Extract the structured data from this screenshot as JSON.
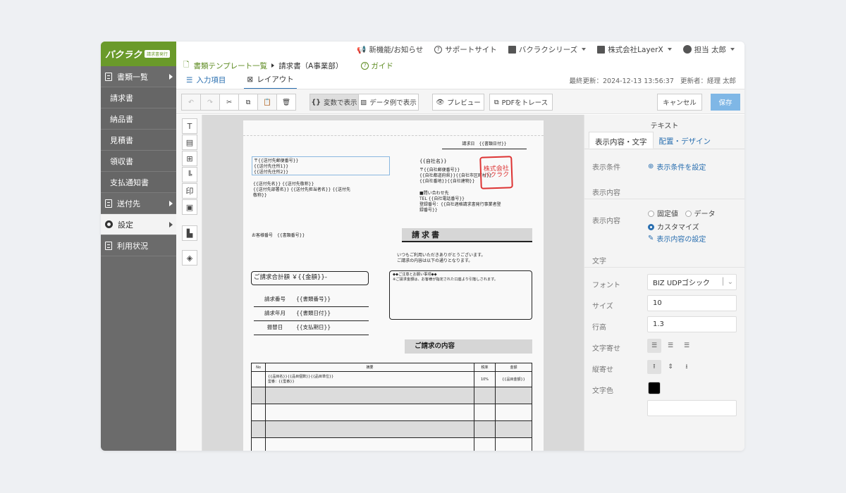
{
  "logo": {
    "text": "バクラク",
    "badge": "請求書発行"
  },
  "sidebar": {
    "items": [
      {
        "label": "書類一覧"
      },
      {
        "label": "請求書"
      },
      {
        "label": "納品書"
      },
      {
        "label": "見積書"
      },
      {
        "label": "領収書"
      },
      {
        "label": "支払通知書"
      },
      {
        "label": "送付先"
      },
      {
        "label": "設定"
      },
      {
        "label": "利用状況"
      }
    ]
  },
  "topbar": {
    "news": "新機能/お知らせ",
    "support": "サポートサイト",
    "series": "バクラクシリーズ",
    "company": "株式会社LayerX",
    "user": "担当 太郎"
  },
  "breadcrumb": {
    "parent": "書類テンプレート一覧",
    "current": "請求書（A事業部）",
    "guide": "ガイド"
  },
  "tabs": {
    "input": "入力項目",
    "layout": "レイアウト"
  },
  "meta": {
    "updated": "最終更新：2024-12-13 13:56:37",
    "updater": "更新者：経理 太郎"
  },
  "toolbar": {
    "var_view": "変数で表示",
    "data_view": "データ例で表示",
    "preview": "プレビュー",
    "trace": "PDFをトレース",
    "cancel": "キャンセル",
    "save": "保存"
  },
  "paper": {
    "issue_date": "請求日　{{書類日付}}",
    "recipient": [
      "〒{{送付先郵便番号}}",
      "{{送付先住所1}}",
      "{{送付先住所2}}"
    ],
    "recipient_name": [
      "{{送付先名}} {{送付先敬称}}",
      "{{送付先部署名}} {{送付先担当者名}} {{送付先",
      "敬称}}"
    ],
    "sender": "{{自社名}}",
    "sender_addr": [
      "〒{{自社郵便番号}}",
      "{{自社都道府県}}{{自社市区町村}}",
      "{{自社番地}}{{自社建物}}"
    ],
    "contact": [
      "■問い合わせ先",
      " TEL {{自社電話番号}}",
      "登録番号：{{自社適格請求書発行事業者登",
      "録番号}}"
    ],
    "seal": "株式会社バクラク",
    "customer_no": "お客様番号　{{書類番号}}",
    "doc_title": "請求書",
    "greeting": [
      "いつもご利用いただきありがとうございます。",
      "ご請求の内容は以下の通りとなります。"
    ],
    "total": "ご請求合計額 ￥{{金額}}-",
    "notice": [
      "◆◆ご注意とお願い事項◆◆",
      "※ご請求金額は、お客様が指定された口座より引落しされます。"
    ],
    "rows": [
      {
        "label": "請求番号",
        "value": "{{書類番号}}"
      },
      {
        "label": "請求年月",
        "value": "{{書類日付}}"
      },
      {
        "label": "振替日",
        "value": "{{支払期日}}"
      }
    ],
    "detail_title": "ご請求の内容",
    "table": {
      "headers": [
        "No",
        "摘要",
        "税率",
        "金額"
      ],
      "item": [
        "{{品目名}}{{品目個数}}{{品目単位}}",
        "型番：{{型番}}"
      ],
      "rate": "10%",
      "amount": "{{品目金額}}"
    }
  },
  "panel": {
    "title": "テキスト",
    "tab1": "表示内容・文字",
    "tab2": "配置・デザイン",
    "cond_label": "表示条件",
    "cond_link": "表示条件を設定",
    "content_section": "表示内容",
    "content_label": "表示内容",
    "opt_fixed": "固定値",
    "opt_data": "データ",
    "opt_custom": "カスタマイズ",
    "content_link": "表示内容の設定",
    "text_section": "文字",
    "font_label": "フォント",
    "font_value": "BIZ UDPゴシック",
    "size_label": "サイズ",
    "size_value": "10",
    "lh_label": "行高",
    "lh_value": "1.3",
    "halign_label": "文字寄せ",
    "valign_label": "縦寄せ",
    "color_label": "文字色",
    "color_value": "#000000"
  }
}
